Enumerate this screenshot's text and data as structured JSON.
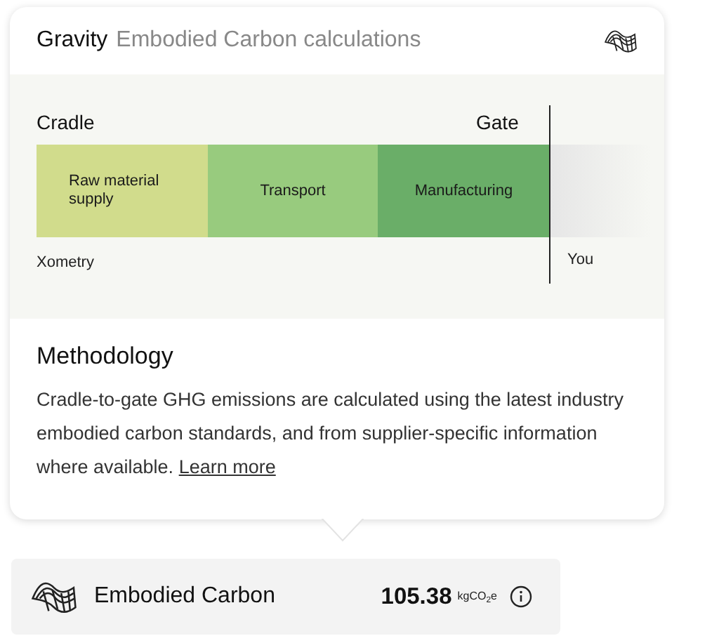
{
  "header": {
    "brand": "Gravity",
    "title": "Embodied Carbon calculations"
  },
  "diagram": {
    "start_label": "Cradle",
    "end_label": "Gate",
    "left_caption": "Xometry",
    "right_caption": "You",
    "segments": [
      {
        "label": "Raw material supply",
        "color": "#d1dc8c"
      },
      {
        "label": "Transport",
        "color": "#98cb7e"
      },
      {
        "label": "Manufacturing",
        "color": "#6aae68"
      }
    ]
  },
  "methodology": {
    "heading": "Methodology",
    "text": "Cradle-to-gate GHG emissions are calculated using the latest industry embodied carbon standards, and from supplier-specific information where available.",
    "link": "Learn more"
  },
  "summary": {
    "label": "Embodied Carbon",
    "value": "105.38",
    "unit": "kgCO$_{2}$e"
  }
}
